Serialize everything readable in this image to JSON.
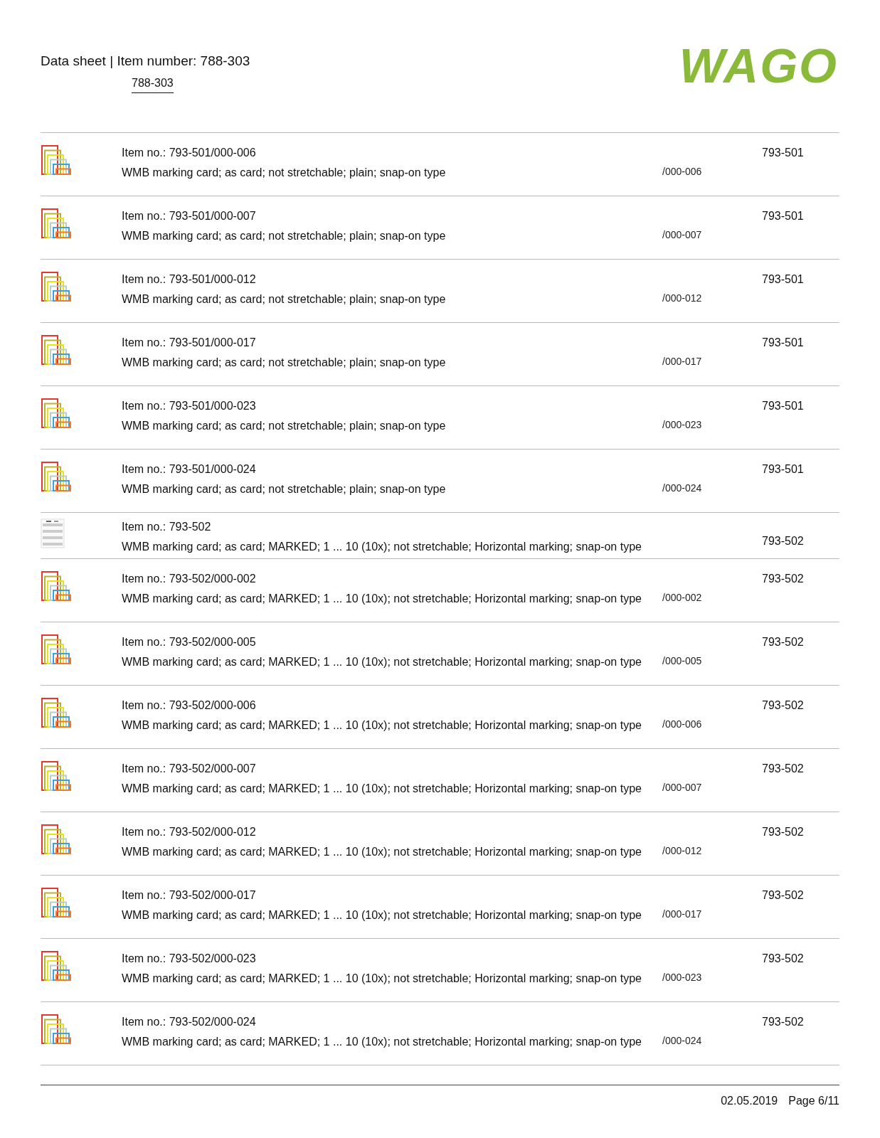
{
  "header": {
    "title": "Data sheet | Item number: 788-303",
    "link": "788-303",
    "logo": "WAGO"
  },
  "rows": [
    {
      "kind": "colored",
      "item": "Item no.: 793-501/000-006",
      "description": "WMB marking card; as card; not stretchable; plain; snap-on type",
      "code": "/000-006",
      "group": "793-501"
    },
    {
      "kind": "colored",
      "item": "Item no.: 793-501/000-007",
      "description": "WMB marking card; as card; not stretchable; plain; snap-on type",
      "code": "/000-007",
      "group": "793-501"
    },
    {
      "kind": "colored",
      "item": "Item no.: 793-501/000-012",
      "description": "WMB marking card; as card; not stretchable; plain; snap-on type",
      "code": "/000-012",
      "group": "793-501"
    },
    {
      "kind": "colored",
      "item": "Item no.: 793-501/000-017",
      "description": "WMB marking card; as card; not stretchable; plain; snap-on type",
      "code": "/000-017",
      "group": "793-501"
    },
    {
      "kind": "colored",
      "item": "Item no.: 793-501/000-023",
      "description": "WMB marking card; as card; not stretchable; plain; snap-on type",
      "code": "/000-023",
      "group": "793-501"
    },
    {
      "kind": "colored",
      "item": "Item no.: 793-501/000-024",
      "description": "WMB marking card; as card; not stretchable; plain; snap-on type",
      "code": "/000-024",
      "group": "793-501"
    },
    {
      "kind": "white",
      "item": "Item no.: 793-502",
      "description": "WMB marking card; as card; MARKED; 1 ... 10 (10x); not stretchable; Horizontal marking; snap-on type",
      "group": "793-502"
    },
    {
      "kind": "colored",
      "item": "Item no.: 793-502/000-002",
      "description": "WMB marking card; as card; MARKED; 1 ... 10 (10x); not stretchable; Horizontal marking; snap-on type",
      "code": "/000-002",
      "group": "793-502"
    },
    {
      "kind": "colored",
      "item": "Item no.: 793-502/000-005",
      "description": "WMB marking card; as card; MARKED; 1 ... 10 (10x); not stretchable; Horizontal marking; snap-on type",
      "code": "/000-005",
      "group": "793-502"
    },
    {
      "kind": "colored",
      "item": "Item no.: 793-502/000-006",
      "description": "WMB marking card; as card; MARKED; 1 ... 10 (10x); not stretchable; Horizontal marking; snap-on type",
      "code": "/000-006",
      "group": "793-502"
    },
    {
      "kind": "colored",
      "item": "Item no.: 793-502/000-007",
      "description": "WMB marking card; as card; MARKED; 1 ... 10 (10x); not stretchable; Horizontal marking; snap-on type",
      "code": "/000-007",
      "group": "793-502"
    },
    {
      "kind": "colored",
      "item": "Item no.: 793-502/000-012",
      "description": "WMB marking card; as card; MARKED; 1 ... 10 (10x); not stretchable; Horizontal marking; snap-on type",
      "code": "/000-012",
      "group": "793-502"
    },
    {
      "kind": "colored",
      "item": "Item no.: 793-502/000-017",
      "description": "WMB marking card; as card; MARKED; 1 ... 10 (10x); not stretchable; Horizontal marking; snap-on type",
      "code": "/000-017",
      "group": "793-502"
    },
    {
      "kind": "colored",
      "item": "Item no.: 793-502/000-023",
      "description": "WMB marking card; as card; MARKED; 1 ... 10 (10x); not stretchable; Horizontal marking; snap-on type",
      "code": "/000-023",
      "group": "793-502"
    },
    {
      "kind": "colored",
      "item": "Item no.: 793-502/000-024",
      "description": "WMB marking card; as card; MARKED; 1 ... 10 (10x); not stretchable; Horizontal marking; snap-on type",
      "code": "/000-024",
      "group": "793-502"
    }
  ],
  "footer": {
    "date": "02.05.2019",
    "page": "Page 6/11"
  }
}
